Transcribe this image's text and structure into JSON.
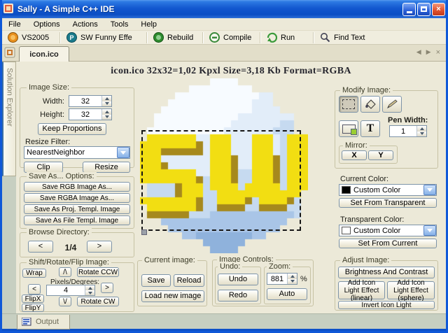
{
  "window": {
    "title": "Sally - A Simple C++ IDE"
  },
  "menu": {
    "items": [
      "File",
      "Options",
      "Actions",
      "Tools",
      "Help"
    ]
  },
  "toolbar": {
    "items": [
      {
        "label": "VS2005",
        "icon": "vs-orb-icon"
      },
      {
        "label": "SW Funny Effe",
        "icon": "sw-effect-icon"
      },
      {
        "label": "Rebuild",
        "icon": "rebuild-icon"
      },
      {
        "label": "Compile",
        "icon": "compile-icon"
      },
      {
        "label": "Run",
        "icon": "run-icon"
      },
      {
        "label": "Find Text",
        "icon": "find-icon"
      }
    ]
  },
  "tabs": {
    "active": "icon.ico"
  },
  "icons": {
    "tab_prev": "◀",
    "tab_next": "▶",
    "tab_close": "×",
    "close": "×"
  },
  "sidebar": {
    "vertical_tab": "Solution Explorer"
  },
  "header": {
    "info": "icon.ico 32x32=1,02 Kpxl Size=3,18 Kb Format=RGBA"
  },
  "image_size": {
    "legend": "Image Size:",
    "width_label": "Width:",
    "width_value": "32",
    "height_label": "Height:",
    "height_value": "32",
    "keep_proportions": "Keep Proportions",
    "resize_filter_label": "Resize Filter:",
    "resize_filter_value": "NearestNeighbor",
    "clip": "Clip",
    "resize": "Resize"
  },
  "save_as": {
    "legend": "Save As... Options:",
    "buttons": [
      "Save RGB Image As...",
      "Save RGBA Image As...",
      "Save As Proj. Templ. Image",
      "Save As File Templ. Image"
    ]
  },
  "browse": {
    "legend": "Browse Directory:",
    "prev": "<",
    "position": "1/4",
    "next": ">"
  },
  "shift_rotate": {
    "legend": "Shift/Rotate/Flip Image:",
    "wrap": "Wrap",
    "up": "/\\",
    "rotate_ccw": "Rotate CCW",
    "pixels_label": "Pixels/Degrees:",
    "left": "<",
    "value": "4",
    "right": ">",
    "flip_x": "FlipX",
    "down": "\\/",
    "rotate_cw": "Rotate CW",
    "flip_y": "FlipY"
  },
  "modify": {
    "legend": "Modify Image:",
    "text_tool": "T",
    "pen_width_label": "Pen Width:",
    "pen_width_value": "1",
    "mirror_legend": "Mirror:",
    "mirror_x": "X",
    "mirror_y": "Y"
  },
  "current_color": {
    "label": "Current Color:",
    "value": "Custom Color",
    "swatch": "#000000",
    "set_button": "Set From Transparent"
  },
  "transparent_color": {
    "label": "Transparent Color:",
    "value": "Custom Color",
    "swatch": "#FFFFFF",
    "set_button": "Set From Current"
  },
  "adjust": {
    "legend": "Adjust Image:",
    "brightness": "Brightness And Contrast",
    "light_linear": "Add Icon Light Effect (linear)",
    "light_sphere": "Add Icon Light Effect (sphere)",
    "invert": "Invert Icon Light"
  },
  "current_image": {
    "legend": "Current image:",
    "save": "Save",
    "reload": "Reload",
    "load_new": "Load new image"
  },
  "image_controls": {
    "legend": "Image Controls:",
    "undo_legend": "Undo:",
    "undo": "Undo",
    "redo": "Redo",
    "zoom_legend": "Zoom:",
    "zoom_value": "881",
    "percent": "%",
    "auto": "Auto"
  },
  "output": {
    "label": "Output"
  },
  "colors": {
    "titlebar_blue": "#1257CF",
    "frame_blue": "#0F58D8",
    "panel_beige": "#ECE9D8",
    "bottom_green": "#C7CFC1",
    "icon_yellow": "#F2DE12",
    "icon_olive": "#A6891D",
    "icon_blue": "#C6DAF0"
  },
  "canvas": {
    "cell_size": 10,
    "palette": {
      "1": "#F7FBFF",
      "2": "#E2EDF9",
      "3": "#C6DAF0",
      "4": "#A9C5E7",
      "5": "#8FB2DC",
      "Y": "#F2DE12",
      "O": "#A6891D"
    },
    "rows": [
      "..........1111..........",
      ".......111111111........",
      ".....11111111111122.....",
      "....111111111111222.....",
      "...11111111111112222....",
      "..11111111111122222222..",
      "..11111111111222222233..",
      ".111111111112222222333..",
      ".YYYYYYY22YYY222YYY23YYY",
      "YYYYYYYYO2YYY222YYY23YYY",
      "YYYOOOOOO2YYY222YYY23YYY",
      "YYY2222222YYYO22YYYO3YYY",
      "YYYO222222YYYO22YYYO3YYY",
      "YYYYYYYY22YYYO33YYYO3YYY",
      "YYYYYYYYO3YYYO33YYYO3YYY",
      ".3333OYYY3YYYY3YYYYY3YYY",
      ".3333OYYY33YYYYYYYYYYYY.",
      "YYYYYYYYO33YYYYO3YYYYO3.",
      ".YYYYYYYO33OOOO33OOOO33.",
      ".OOOOOO3334444444444443.",
      "...444444444444444444...",
      "....4444444444444444....",
      "......445555555544......",
      ".........555555.........",
      "..........5555.........."
    ]
  }
}
